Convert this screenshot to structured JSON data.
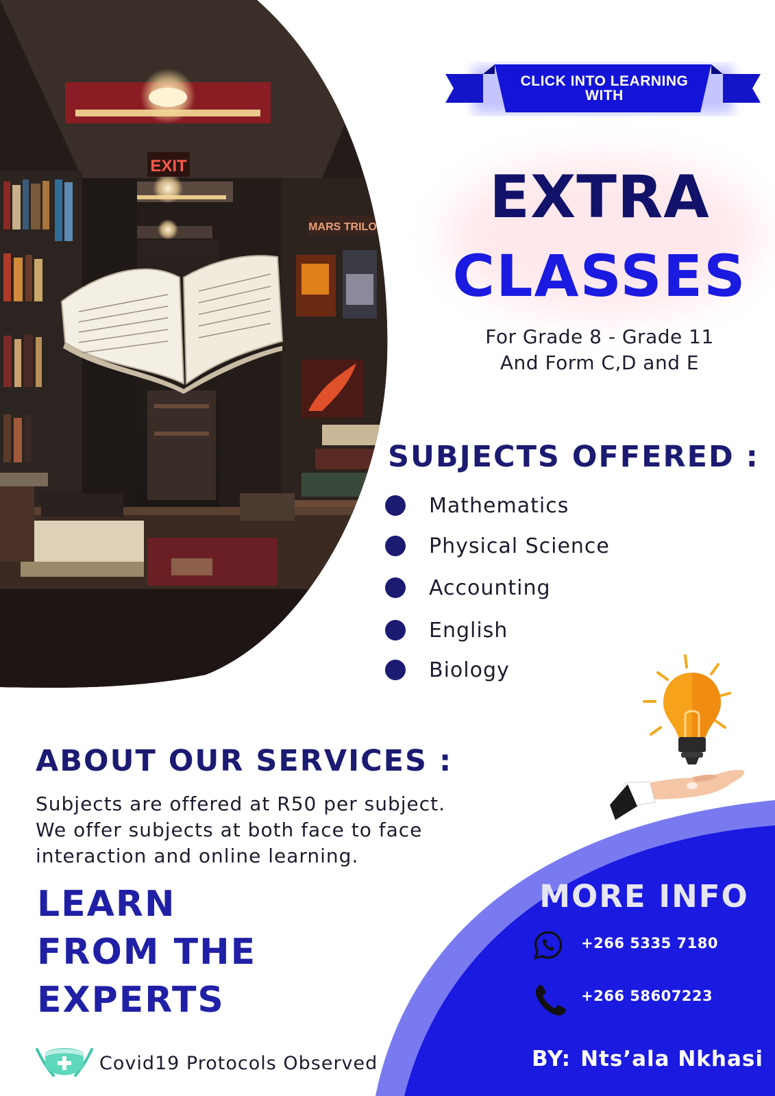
{
  "banner": {
    "line_1": "CLICK INTO LEARNING",
    "line_2": "WITH"
  },
  "headline": {
    "line_1": "EXTRA",
    "line_2": "CLASSES"
  },
  "grades": {
    "line_1": "For Grade 8 - Grade 11",
    "line_2": "And Form C,D and E"
  },
  "subjects": {
    "heading": "SUBJECTS OFFERED :",
    "items": [
      "Mathematics",
      "Physical Science",
      "Accounting",
      "English",
      "Biology"
    ]
  },
  "about": {
    "heading": "ABOUT OUR SERVICES :",
    "lines": [
      "Subjects are offered at R50 per subject.",
      "We offer subjects at both face to face",
      "interaction and online learning."
    ]
  },
  "slogan": {
    "lines": [
      "LEARN",
      "FROM THE",
      "EXPERTS"
    ]
  },
  "covid": {
    "text": "Covid19 Protocols Observed"
  },
  "contact": {
    "heading": "MORE INFO",
    "whatsapp": "+266 5335 7180",
    "phone": "+266 58607223",
    "by_label": "BY:",
    "by_name": "Nts’ala Nkhasi"
  },
  "icons": {
    "whatsapp": "whatsapp-icon",
    "phone": "phone-icon",
    "mask": "face-mask-icon",
    "bulb": "light-bulb-icon",
    "hand": "open-hand-icon"
  },
  "colors": {
    "navy": "#1b1b72",
    "royal_blue": "#1a1ae0",
    "light_blue": "#7a7af0",
    "bulb_orange": "#f7a21b",
    "mask_teal": "#3ec6a8"
  }
}
